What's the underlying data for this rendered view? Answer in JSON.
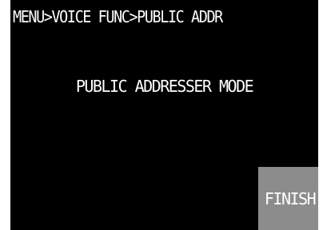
{
  "header": {
    "breadcrumb": "MENU>VOICE FUNC>PUBLIC ADDR"
  },
  "main": {
    "mode_title": "PUBLIC ADDRESSER MODE"
  },
  "actions": {
    "finish_label": "FINISH"
  },
  "colors": {
    "background": "#000000",
    "text": "#ffffff",
    "button": "#8c8c8c"
  }
}
